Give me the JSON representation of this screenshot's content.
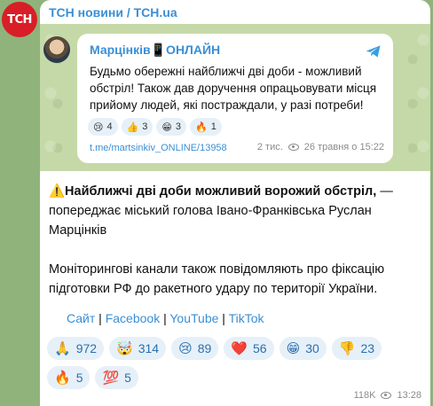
{
  "channel": {
    "avatar_text": "ТСН",
    "title": "ТСН новини / TCH.ua"
  },
  "forward": {
    "name": "Марцінків📱ОНЛАЙН",
    "text": "Будьмо обережні найближчі дві доби - можливий обстріл! Також дав доручення опрацьовувати місця прийому людей, які постраждали, у разі потреби!",
    "reactions": [
      {
        "emoji": "😢",
        "count": "4"
      },
      {
        "emoji": "👍",
        "count": "3"
      },
      {
        "emoji": "😁",
        "count": "3"
      },
      {
        "emoji": "🔥",
        "count": "1"
      }
    ],
    "link": "t.me/martsinkiv_ONLINE/13958",
    "views": "2 тис.",
    "date": "26 травня о 15:22"
  },
  "post": {
    "bold_lead": "⚠️Найближчі дві доби можливий ворожий обстріл,",
    "lead_rest": " — попереджає міський голова Івано-Франківська Руслан Марцінків",
    "paragraph2": "Моніторингові канали також повідомляють про фіксацію підготовки РФ до ракетного удару по території України.",
    "links": [
      "Сайт",
      "Facebook",
      "YouTube",
      "TikTok"
    ],
    "separator": " | "
  },
  "reactions": [
    {
      "emoji": "🙏",
      "count": "972"
    },
    {
      "emoji": "🤯",
      "count": "314"
    },
    {
      "emoji": "😢",
      "count": "89"
    },
    {
      "emoji": "❤️",
      "count": "56"
    },
    {
      "emoji": "😁",
      "count": "30"
    },
    {
      "emoji": "👎",
      "count": "23"
    },
    {
      "emoji": "🔥",
      "count": "5"
    },
    {
      "emoji": "💯",
      "count": "5"
    }
  ],
  "meta": {
    "views": "118K",
    "time": "13:28"
  }
}
